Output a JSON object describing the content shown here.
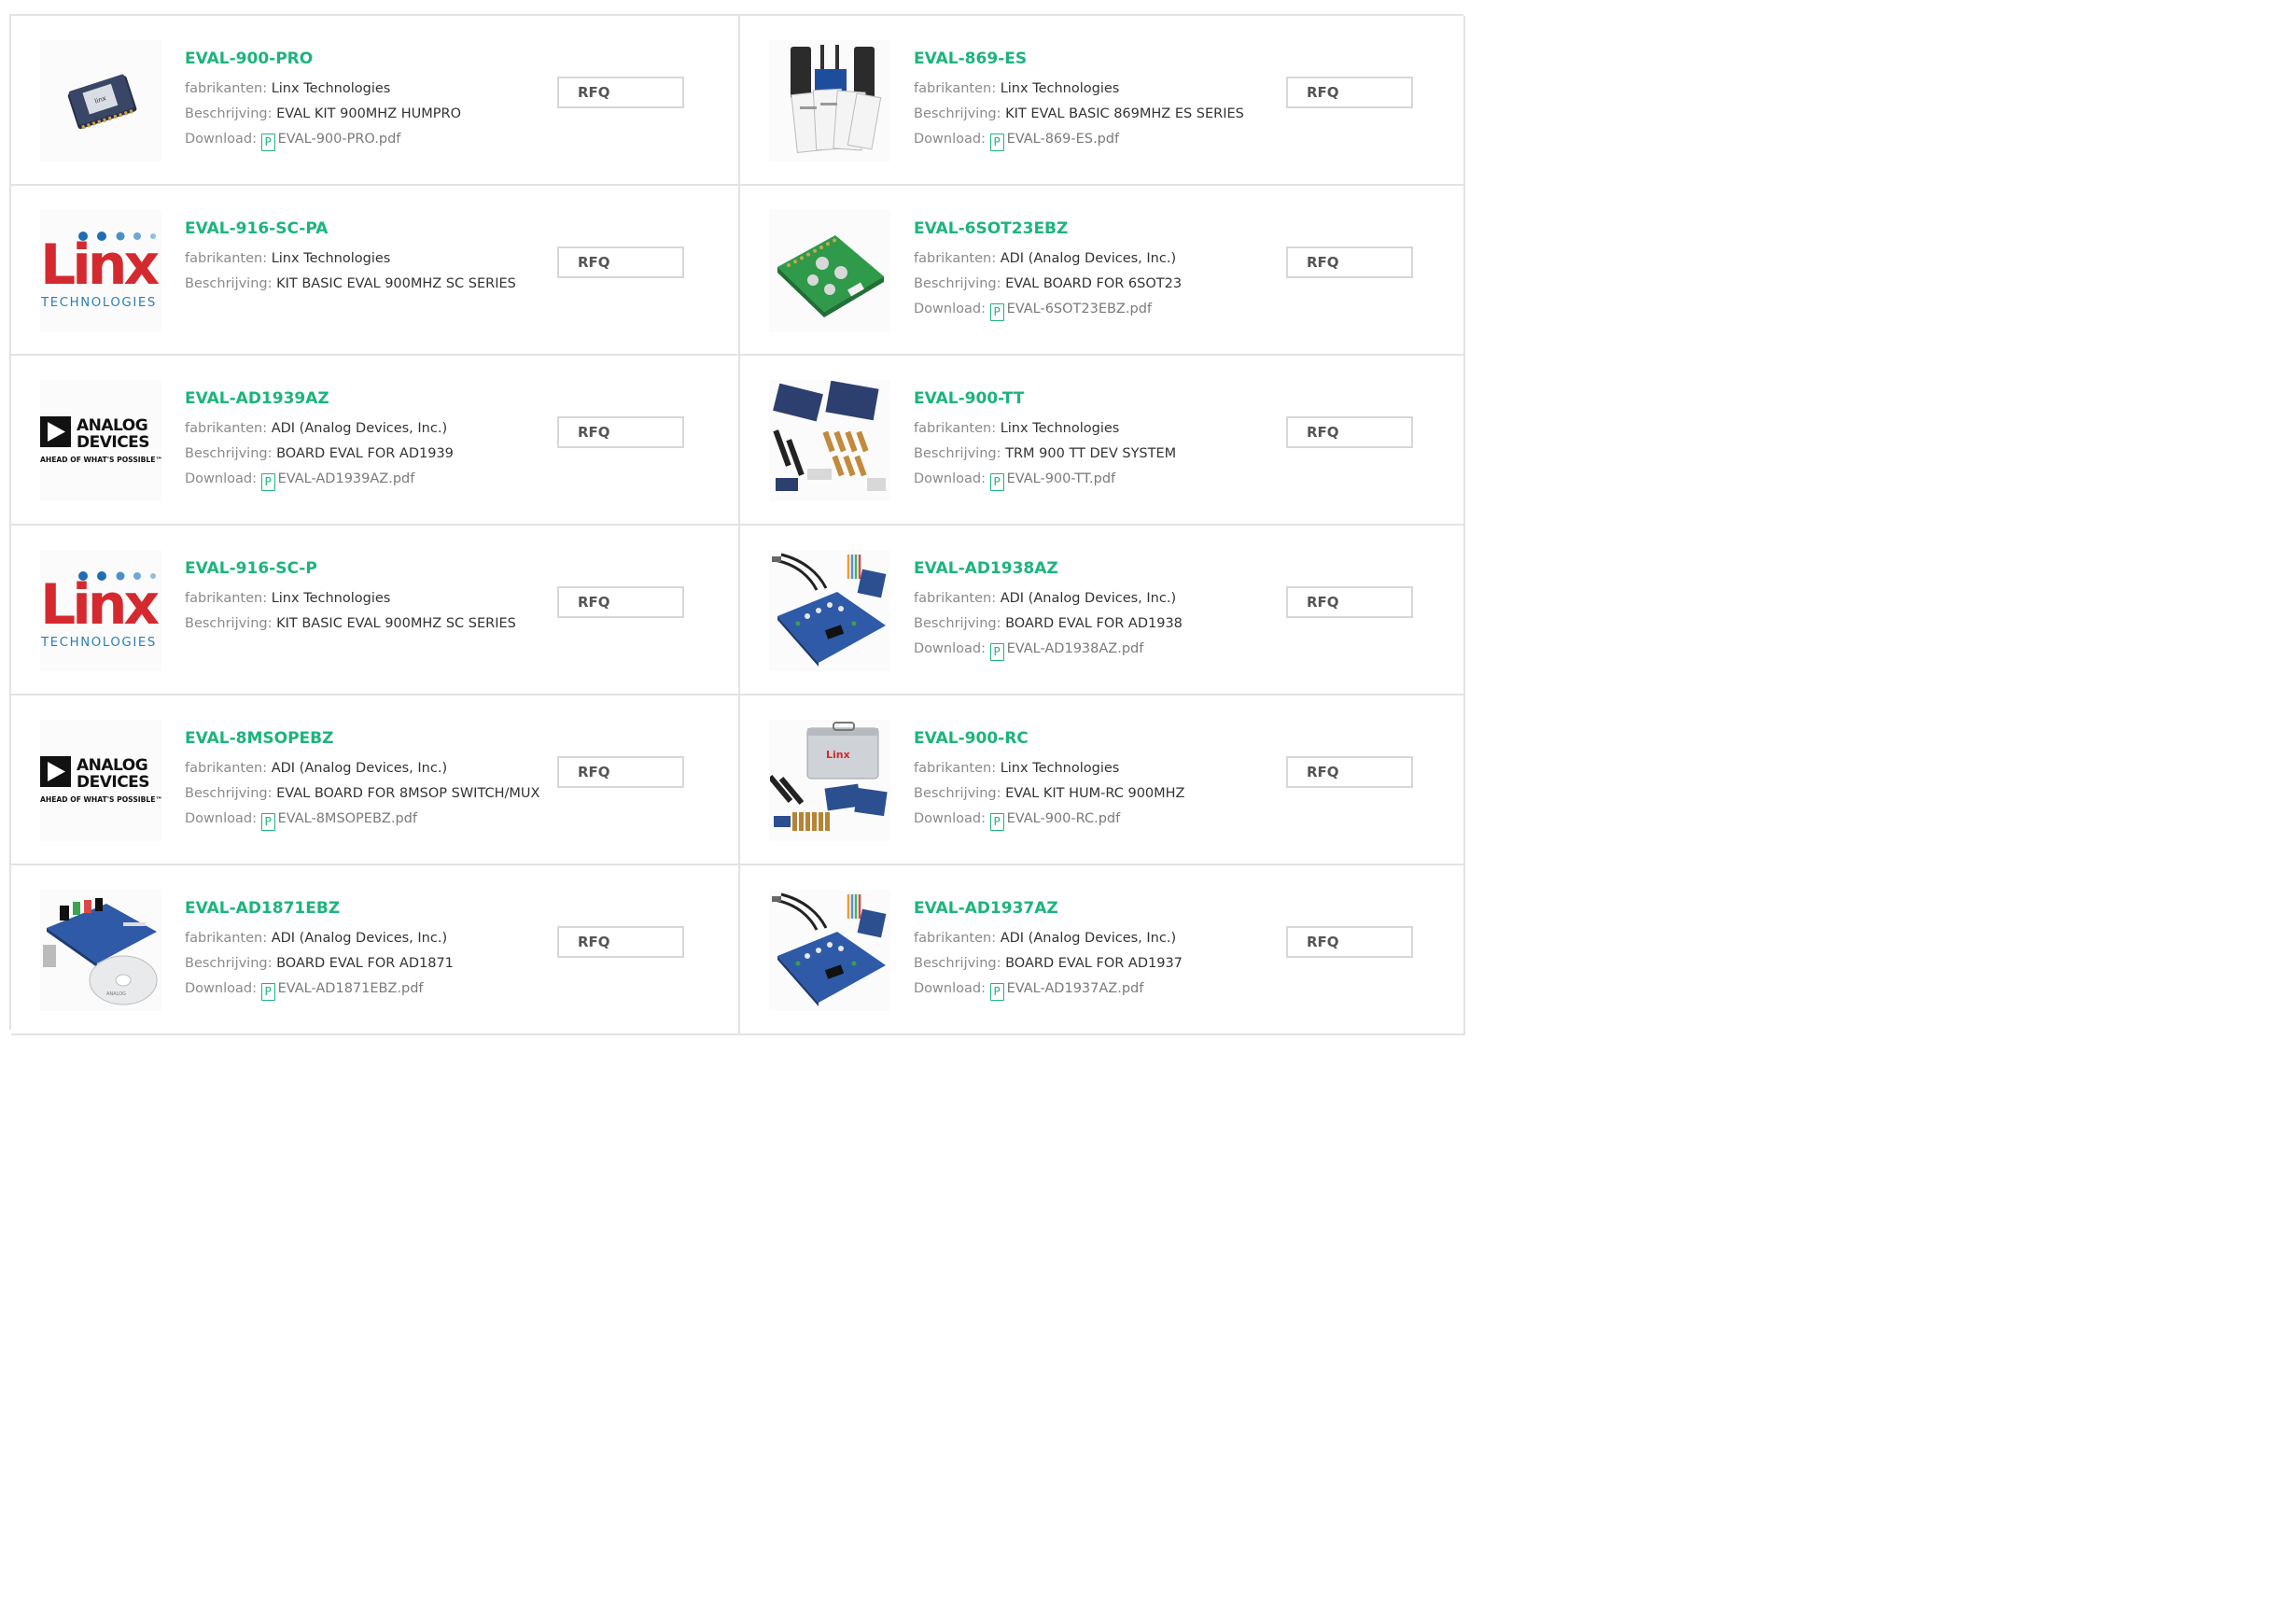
{
  "labels": {
    "manufacturer": "fabrikanten:",
    "description": "Beschrijving:",
    "download": "Download:",
    "rfq": "RFQ"
  },
  "colors": {
    "accent": "#1db47c",
    "border": "#e3e3e3"
  },
  "products": [
    {
      "name": "EVAL-900-PRO",
      "manufacturer": "Linx Technologies",
      "description": "EVAL KIT 900MHZ HUMPRO",
      "download": "EVAL-900-PRO.pdf",
      "image": "rf-module-chip"
    },
    {
      "name": "EVAL-869-ES",
      "manufacturer": "Linx Technologies",
      "description": "KIT EVAL BASIC 869MHZ ES SERIES",
      "download": "EVAL-869-ES.pdf",
      "image": "kit-manuals-antennas"
    },
    {
      "name": "EVAL-916-SC-PA",
      "manufacturer": "Linx Technologies",
      "description": "KIT BASIC EVAL 900MHZ SC SERIES",
      "download": "",
      "image": "linx-logo",
      "logo_text": "Linx",
      "logo_sub": "TECHNOLOGIES"
    },
    {
      "name": "EVAL-6SOT23EBZ",
      "manufacturer": "ADI (Analog Devices, Inc.)",
      "description": "EVAL BOARD FOR 6SOT23",
      "download": "EVAL-6SOT23EBZ.pdf",
      "image": "green-pcb"
    },
    {
      "name": "EVAL-AD1939AZ",
      "manufacturer": "ADI (Analog Devices, Inc.)",
      "description": "BOARD EVAL FOR AD1939",
      "download": "EVAL-AD1939AZ.pdf",
      "image": "analog-devices-logo",
      "logo_text": "ANALOG DEVICES",
      "logo_sub": "AHEAD OF WHAT'S POSSIBLE™"
    },
    {
      "name": "EVAL-900-TT",
      "manufacturer": "Linx Technologies",
      "description": "TRM 900 TT DEV SYSTEM",
      "download": "EVAL-900-TT.pdf",
      "image": "dev-system-kit"
    },
    {
      "name": "EVAL-916-SC-P",
      "manufacturer": "Linx Technologies",
      "description": "KIT BASIC EVAL 900MHZ SC SERIES",
      "download": "",
      "image": "linx-logo",
      "logo_text": "Linx",
      "logo_sub": "TECHNOLOGIES"
    },
    {
      "name": "EVAL-AD1938AZ",
      "manufacturer": "ADI (Analog Devices, Inc.)",
      "description": "BOARD EVAL FOR AD1938",
      "download": "EVAL-AD1938AZ.pdf",
      "image": "blue-board-cables"
    },
    {
      "name": "EVAL-8MSOPEBZ",
      "manufacturer": "ADI (Analog Devices, Inc.)",
      "description": "EVAL BOARD FOR 8MSOP SWITCH/MUX",
      "download": "EVAL-8MSOPEBZ.pdf",
      "image": "analog-devices-logo",
      "logo_text": "ANALOG DEVICES",
      "logo_sub": "AHEAD OF WHAT'S POSSIBLE™"
    },
    {
      "name": "EVAL-900-RC",
      "manufacturer": "Linx Technologies",
      "description": "EVAL KIT HUM-RC 900MHZ",
      "download": "EVAL-900-RC.pdf",
      "image": "kit-case"
    },
    {
      "name": "EVAL-AD1871EBZ",
      "manufacturer": "ADI (Analog Devices, Inc.)",
      "description": "BOARD EVAL FOR AD1871",
      "download": "EVAL-AD1871EBZ.pdf",
      "image": "board-with-cd"
    },
    {
      "name": "EVAL-AD1937AZ",
      "manufacturer": "ADI (Analog Devices, Inc.)",
      "description": "BOARD EVAL FOR AD1937",
      "download": "EVAL-AD1937AZ.pdf",
      "image": "blue-board-cables"
    }
  ]
}
